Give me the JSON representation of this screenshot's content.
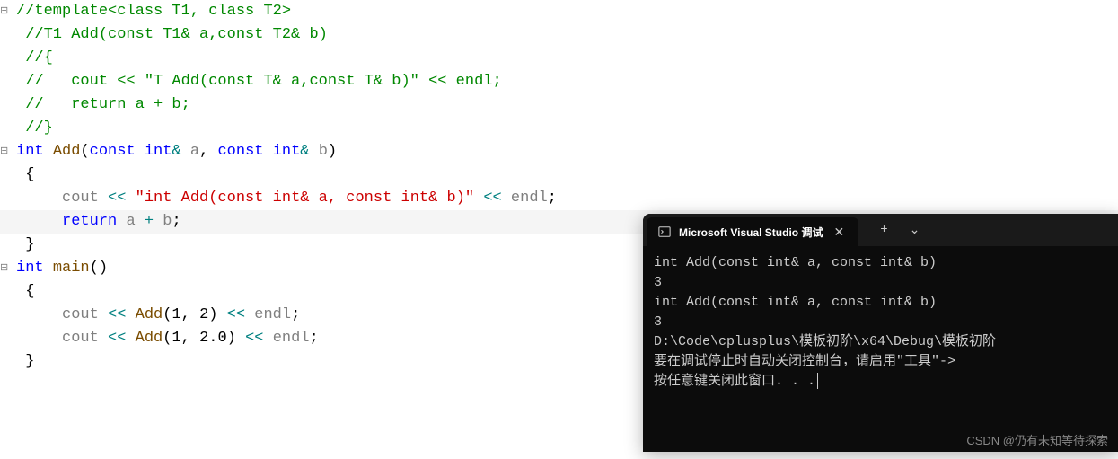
{
  "editor": {
    "lines": [
      {
        "fold": "⊟",
        "segments": [
          {
            "cls": "comment",
            "t": "//template<class T1, class T2>"
          }
        ]
      },
      {
        "fold": "",
        "segments": [
          {
            "cls": "comment",
            "t": " //T1 Add(const T1& a,const T2& b)"
          }
        ]
      },
      {
        "fold": "",
        "segments": [
          {
            "cls": "comment",
            "t": " //{"
          }
        ]
      },
      {
        "fold": "",
        "segments": [
          {
            "cls": "comment",
            "t": " //   cout << \"T Add(const T& a,const T& b)\" << endl;"
          }
        ]
      },
      {
        "fold": "",
        "segments": [
          {
            "cls": "comment",
            "t": " //   return a + b;"
          }
        ]
      },
      {
        "fold": "",
        "segments": [
          {
            "cls": "comment",
            "t": " //}"
          }
        ]
      },
      {
        "fold": "⊟",
        "segments": [
          {
            "cls": "keyword",
            "t": "int"
          },
          {
            "cls": "black",
            "t": " "
          },
          {
            "cls": "func",
            "t": "Add"
          },
          {
            "cls": "paren",
            "t": "("
          },
          {
            "cls": "keyword",
            "t": "const"
          },
          {
            "cls": "black",
            "t": " "
          },
          {
            "cls": "keyword",
            "t": "int"
          },
          {
            "cls": "op",
            "t": "&"
          },
          {
            "cls": "black",
            "t": " "
          },
          {
            "cls": "ident",
            "t": "a"
          },
          {
            "cls": "black",
            "t": ", "
          },
          {
            "cls": "keyword",
            "t": "const"
          },
          {
            "cls": "black",
            "t": " "
          },
          {
            "cls": "keyword",
            "t": "int"
          },
          {
            "cls": "op",
            "t": "&"
          },
          {
            "cls": "black",
            "t": " "
          },
          {
            "cls": "ident",
            "t": "b"
          },
          {
            "cls": "paren",
            "t": ")"
          }
        ]
      },
      {
        "fold": "",
        "segments": [
          {
            "cls": "black",
            "t": " {"
          }
        ]
      },
      {
        "fold": "",
        "segments": [
          {
            "cls": "black",
            "t": "     "
          },
          {
            "cls": "ident",
            "t": "cout"
          },
          {
            "cls": "black",
            "t": " "
          },
          {
            "cls": "op",
            "t": "<<"
          },
          {
            "cls": "black",
            "t": " "
          },
          {
            "cls": "string",
            "t": "\"int Add(const int& a, const int& b)\""
          },
          {
            "cls": "black",
            "t": " "
          },
          {
            "cls": "op",
            "t": "<<"
          },
          {
            "cls": "black",
            "t": " "
          },
          {
            "cls": "ident",
            "t": "endl"
          },
          {
            "cls": "black",
            "t": ";"
          }
        ]
      },
      {
        "fold": "",
        "highlighted": true,
        "segments": [
          {
            "cls": "black",
            "t": "     "
          },
          {
            "cls": "keyword",
            "t": "return"
          },
          {
            "cls": "black",
            "t": " "
          },
          {
            "cls": "ident",
            "t": "a"
          },
          {
            "cls": "black",
            "t": " "
          },
          {
            "cls": "op",
            "t": "+"
          },
          {
            "cls": "black",
            "t": " "
          },
          {
            "cls": "ident",
            "t": "b"
          },
          {
            "cls": "black",
            "t": ";"
          }
        ]
      },
      {
        "fold": "",
        "segments": [
          {
            "cls": "black",
            "t": " }"
          }
        ]
      },
      {
        "fold": "",
        "segments": [
          {
            "cls": "black",
            "t": ""
          }
        ]
      },
      {
        "fold": "⊟",
        "segments": [
          {
            "cls": "keyword",
            "t": "int"
          },
          {
            "cls": "black",
            "t": " "
          },
          {
            "cls": "func",
            "t": "main"
          },
          {
            "cls": "paren",
            "t": "()"
          }
        ]
      },
      {
        "fold": "",
        "segments": [
          {
            "cls": "black",
            "t": " {"
          }
        ]
      },
      {
        "fold": "",
        "segments": [
          {
            "cls": "black",
            "t": "     "
          },
          {
            "cls": "ident",
            "t": "cout"
          },
          {
            "cls": "black",
            "t": " "
          },
          {
            "cls": "op",
            "t": "<<"
          },
          {
            "cls": "black",
            "t": " "
          },
          {
            "cls": "func",
            "t": "Add"
          },
          {
            "cls": "paren",
            "t": "("
          },
          {
            "cls": "num",
            "t": "1"
          },
          {
            "cls": "black",
            "t": ", "
          },
          {
            "cls": "num",
            "t": "2"
          },
          {
            "cls": "paren",
            "t": ")"
          },
          {
            "cls": "black",
            "t": " "
          },
          {
            "cls": "op",
            "t": "<<"
          },
          {
            "cls": "black",
            "t": " "
          },
          {
            "cls": "ident",
            "t": "endl"
          },
          {
            "cls": "black",
            "t": ";"
          }
        ]
      },
      {
        "fold": "",
        "segments": [
          {
            "cls": "black",
            "t": "     "
          },
          {
            "cls": "ident",
            "t": "cout"
          },
          {
            "cls": "black",
            "t": " "
          },
          {
            "cls": "op",
            "t": "<<"
          },
          {
            "cls": "black",
            "t": " "
          },
          {
            "cls": "func",
            "t": "Add"
          },
          {
            "cls": "paren",
            "t": "("
          },
          {
            "cls": "num",
            "t": "1"
          },
          {
            "cls": "black",
            "t": ", "
          },
          {
            "cls": "num",
            "t": "2.0"
          },
          {
            "cls": "paren",
            "t": ")"
          },
          {
            "cls": "black",
            "t": " "
          },
          {
            "cls": "op",
            "t": "<<"
          },
          {
            "cls": "black",
            "t": " "
          },
          {
            "cls": "ident",
            "t": "endl"
          },
          {
            "cls": "black",
            "t": ";"
          }
        ]
      },
      {
        "fold": "",
        "segments": [
          {
            "cls": "black",
            "t": " }"
          }
        ]
      }
    ]
  },
  "terminal": {
    "tab_title": "Microsoft Visual Studio 调试",
    "output": [
      "int Add(const int& a, const int& b)",
      "3",
      "int Add(const int& a, const int& b)",
      "3",
      "",
      "D:\\Code\\cplusplus\\模板初阶\\x64\\Debug\\模板初阶",
      "要在调试停止时自动关闭控制台，请启用\"工具\"->",
      "按任意键关闭此窗口. . ."
    ]
  },
  "watermark": "CSDN @仍有未知等待探索"
}
